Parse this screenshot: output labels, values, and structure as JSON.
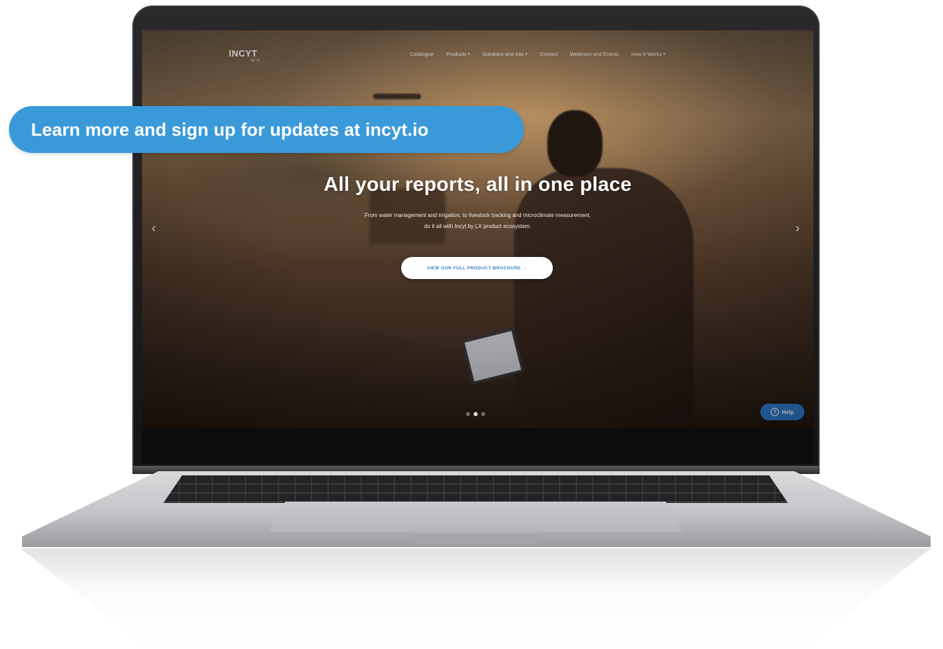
{
  "callout": {
    "text": "Learn more and sign up for updates at incyt.io"
  },
  "site": {
    "logo": "INCYT",
    "logo_sub": "by LX",
    "nav": [
      {
        "label": "Catalogue",
        "has_dropdown": false
      },
      {
        "label": "Products",
        "has_dropdown": true
      },
      {
        "label": "Solutions and Kits",
        "has_dropdown": true
      },
      {
        "label": "Contact",
        "has_dropdown": false
      },
      {
        "label": "Webinars and Events",
        "has_dropdown": false
      },
      {
        "label": "How it Works",
        "has_dropdown": true
      }
    ],
    "hero": {
      "title": "All your reports, all in one place",
      "subtitle_line1": "From water management and irrigation, to livestock tracking and microclimate measurement,",
      "subtitle_line2": "do it all with Incyt by LX product ecosystem.",
      "cta": "VIEW OUR FULL PRODUCT BROCHURE →"
    },
    "carousel": {
      "slides": 3,
      "active": 2,
      "prev_icon": "‹",
      "next_icon": "›"
    },
    "help": {
      "label": "Help",
      "icon": "?"
    }
  },
  "colors": {
    "callout_bg": "#3a9ad9",
    "cta_text": "#3a7fc6",
    "help_bg": "#2f78c9"
  }
}
